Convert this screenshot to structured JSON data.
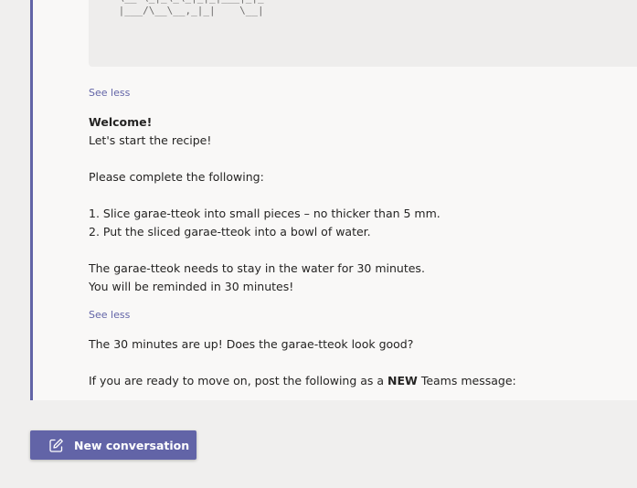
{
  "thread": {
    "ascii_art": " \\__ \\_|_\\_\\_|_|_|___|_|_\n |___/\\__\\__,_|_|    \\__|",
    "see_less_1": "See less",
    "welcome_title": "Welcome!",
    "welcome_line": "Let's start the recipe!",
    "instructions_intro": "Please complete the following:",
    "step_1": "1. Slice garae-tteok into small pieces – no thicker than 5 mm.",
    "step_2": "2. Put the sliced garae-tteok into a bowl of water.",
    "note_1": "The garae-tteok needs to stay in the water for 30 minutes.",
    "note_2": "You will be reminded in 30 minutes!",
    "see_less_2": "See less",
    "reminder": "The 30 minutes are up! Does the garae-tteok look good?",
    "ready_prefix": "If you are ready to move on, post the following as a ",
    "ready_bold": "NEW",
    "ready_suffix": " Teams message:"
  },
  "new_conversation": {
    "label": "New conversation",
    "icon": "compose-icon"
  },
  "colors": {
    "accent": "#6264a7",
    "background": "#f0efee",
    "thread_background": "#f9f8f7",
    "code_background": "#eeedec"
  }
}
